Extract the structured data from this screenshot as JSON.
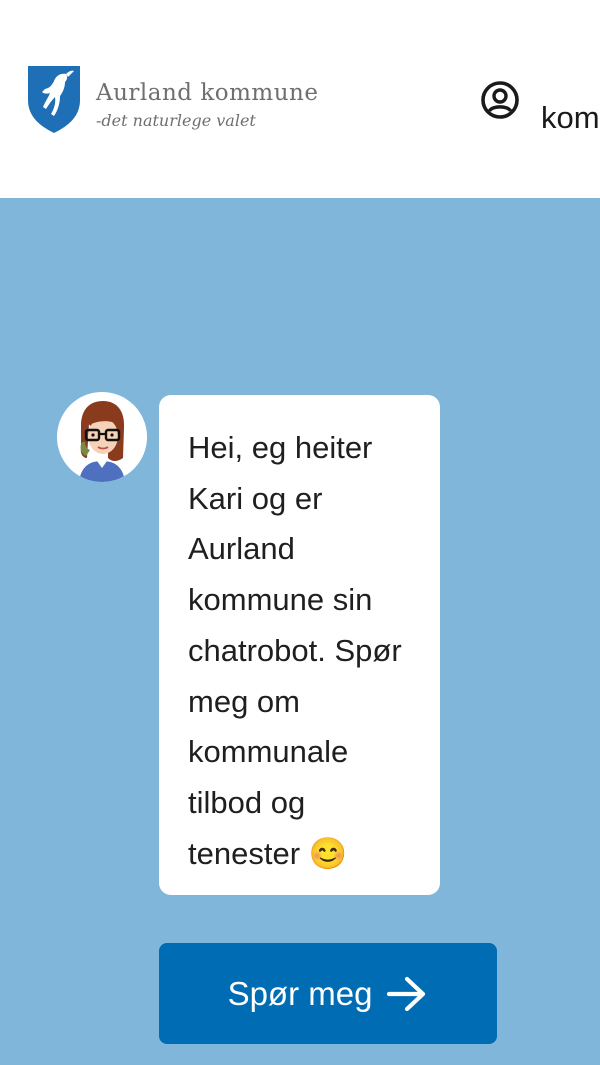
{
  "header": {
    "logo": {
      "name": "Aurland kommune",
      "tagline": "-det naturlege valet",
      "icon": "goat-shield-icon"
    },
    "user_icon": "user-circle-icon",
    "link_text": "kom"
  },
  "chat": {
    "avatar_icon": "kari-chatbot-avatar",
    "message": "Hei, eg heiter Kari og er Aurland kommune sin chatrobot. Spør meg om kommunale tilbod og tenester 😊"
  },
  "cta": {
    "label": "Spør meg",
    "icon": "arrow-right-icon"
  },
  "colors": {
    "hero_background": "#7fb6da",
    "button_background": "#006cb4",
    "shield_blue": "#1e6fb5"
  }
}
